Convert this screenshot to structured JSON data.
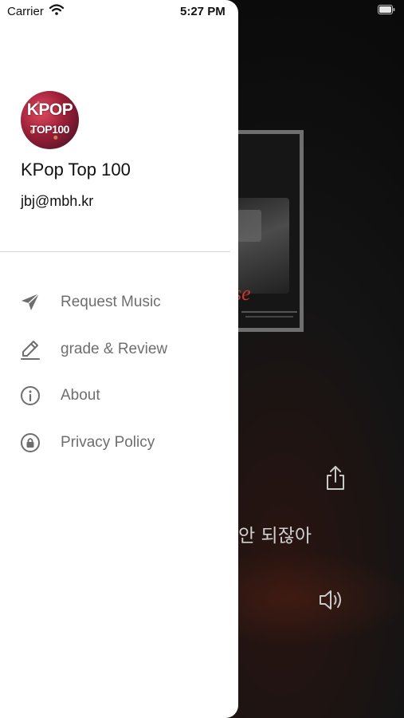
{
  "status_bar": {
    "carrier": "Carrier",
    "time": "5:27 PM"
  },
  "drawer": {
    "avatar_logo_line1": "KPOP",
    "avatar_logo_line2": "TOP100",
    "app_name": "KPop Top 100",
    "email": "jbj@mbh.kr",
    "menu": [
      {
        "label": "Request Music",
        "icon": "paper-plane-icon"
      },
      {
        "label": "grade & Review",
        "icon": "pencil-icon"
      },
      {
        "label": "About",
        "icon": "info-icon"
      },
      {
        "label": "Privacy Policy",
        "icon": "lock-icon"
      }
    ]
  },
  "player": {
    "album_text": "se",
    "lyric": "| 안 되잖아"
  },
  "colors": {
    "drawer_bg": "#ffffff",
    "menu_text": "#6e6e6e",
    "player_bg": "#0b0b0b"
  }
}
